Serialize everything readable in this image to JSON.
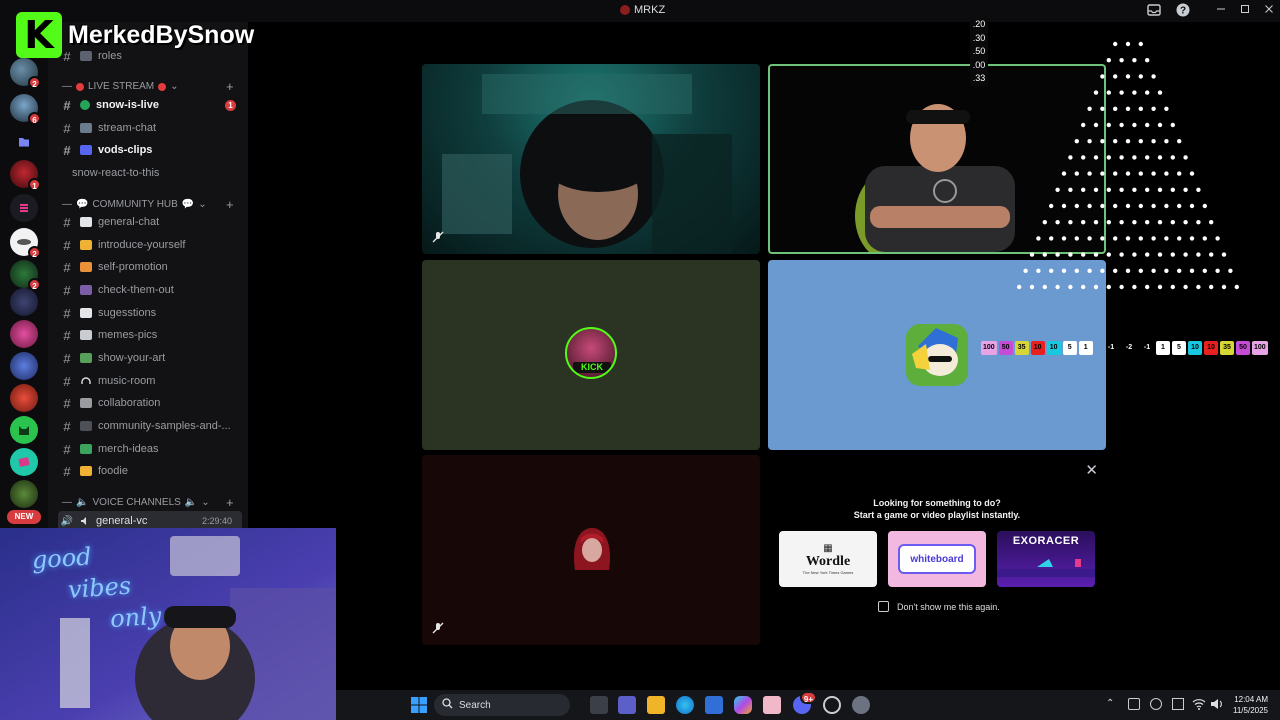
{
  "window": {
    "title": "MRKZ"
  },
  "overlay_logo": {
    "letter": "K",
    "name": "MerkedBySnow"
  },
  "servers": [
    {
      "badge": "2"
    },
    {
      "badge": "6"
    },
    {
      "badge": ""
    },
    {
      "badge": "1"
    },
    {
      "badge": ""
    },
    {
      "badge": "2"
    },
    {
      "badge": "2"
    },
    {
      "badge": ""
    },
    {
      "badge": ""
    },
    {
      "badge": ""
    },
    {
      "badge": ""
    },
    {
      "badge": ""
    },
    {
      "badge": ""
    },
    {
      "badge": ""
    }
  ],
  "new_label": "NEW",
  "sidebar": {
    "top_channel": "roles",
    "live_stream": {
      "category": "LIVE STREAM",
      "channels": [
        {
          "name": "snow-is-live",
          "unread": "1",
          "emoji_color": "#23a559"
        },
        {
          "name": "stream-chat",
          "emoji_color": "#6b7a8f"
        },
        {
          "name": "vods-clips",
          "emoji_color": "#5865f2"
        },
        {
          "name": "snow-react-to-this"
        }
      ]
    },
    "community_hub": {
      "category": "COMMUNITY HUB",
      "channels": [
        {
          "name": "general-chat",
          "emoji_color": "#e3e5e8"
        },
        {
          "name": "introduce-yourself",
          "emoji_color": "#f0b232"
        },
        {
          "name": "self-promotion",
          "emoji_color": "#e8913a"
        },
        {
          "name": "check-them-out",
          "emoji_color": "#7b5ea7"
        },
        {
          "name": "sugesstions",
          "emoji_color": "#e3e5e8"
        },
        {
          "name": "memes-pics",
          "emoji_color": "#c9ccd1"
        },
        {
          "name": "show-your-art",
          "emoji_color": "#57a05a"
        },
        {
          "name": "music-room",
          "emoji_color": "#dbdee1"
        },
        {
          "name": "collaboration",
          "emoji_color": "#9a9ca1"
        },
        {
          "name": "community-samples-and-...",
          "emoji_color": "#4e5058"
        },
        {
          "name": "merch-ideas",
          "emoji_color": "#3ba55d"
        },
        {
          "name": "foodie",
          "emoji_color": "#f0b232"
        }
      ]
    },
    "voice": {
      "category": "VOICE CHANNELS",
      "channel": {
        "name": "general-vc",
        "time": "2:29:40"
      }
    }
  },
  "odds": [
    ".20",
    ".30",
    ".50",
    ".00",
    ".33"
  ],
  "slots_left": [
    {
      "label": "100",
      "color": "#e8a3e8"
    },
    {
      "label": "50",
      "color": "#c64bd6"
    },
    {
      "label": "35",
      "color": "#d6d637"
    },
    {
      "label": "10",
      "color": "#e82020"
    },
    {
      "label": "10",
      "color": "#18c7e0"
    },
    {
      "label": "5",
      "color": "#ffffff"
    },
    {
      "label": "1",
      "color": "#ffffff"
    }
  ],
  "slots_mid": [
    "-1",
    "-2",
    "-1"
  ],
  "slots_right": [
    {
      "label": "1",
      "color": "#ffffff"
    },
    {
      "label": "5",
      "color": "#ffffff"
    },
    {
      "label": "10",
      "color": "#18c7e0"
    },
    {
      "label": "10",
      "color": "#e82020"
    },
    {
      "label": "35",
      "color": "#d6d637"
    },
    {
      "label": "50",
      "color": "#c64bd6"
    },
    {
      "label": "100",
      "color": "#e8a3e8"
    }
  ],
  "popup": {
    "line1": "Looking for something to do?",
    "line2": "Start a game or video playlist instantly.",
    "cards": [
      {
        "title": "Wordle",
        "subtitle": "The New York Times Games"
      },
      {
        "title": "whiteboard",
        "subtitle": ""
      },
      {
        "title": "EXORACER",
        "subtitle": ""
      }
    ],
    "dont_show": "Don't show me this again."
  },
  "kick_label": "KICK",
  "webcam_sign": [
    "good",
    "vibes",
    "only"
  ],
  "taskbar": {
    "search": "Search",
    "time": "12:04 AM",
    "date": "11/5/2025",
    "discord_badge": "9+"
  }
}
